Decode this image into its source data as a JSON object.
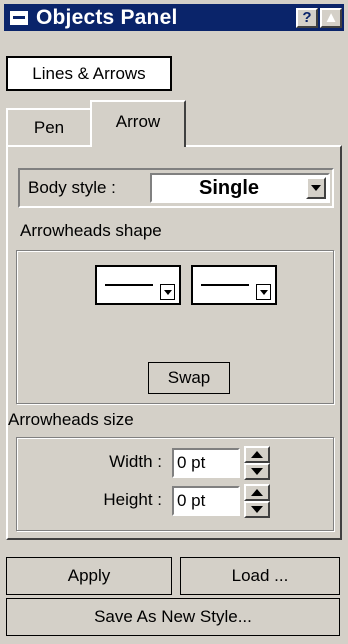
{
  "window": {
    "title": "Objects Panel",
    "help_label": "?",
    "collapse_label": "▲"
  },
  "category_button": "Lines & Arrows",
  "tabs": [
    {
      "label": "Pen"
    },
    {
      "label": "Arrow"
    }
  ],
  "body_style": {
    "label": "Body style :",
    "value": "Single"
  },
  "arrowheads_shape": {
    "label": "Arrowheads shape",
    "swap_label": "Swap"
  },
  "arrowheads_size": {
    "label": "Arrowheads size",
    "width_label": "Width :",
    "width_value": "0 pt",
    "height_label": "Height :",
    "height_value": "0 pt"
  },
  "buttons": {
    "apply": "Apply",
    "load": "Load ...",
    "save_as": "Save As New Style..."
  },
  "colors": {
    "titlebar": "#0a246a",
    "face": "#d4d0c8"
  }
}
